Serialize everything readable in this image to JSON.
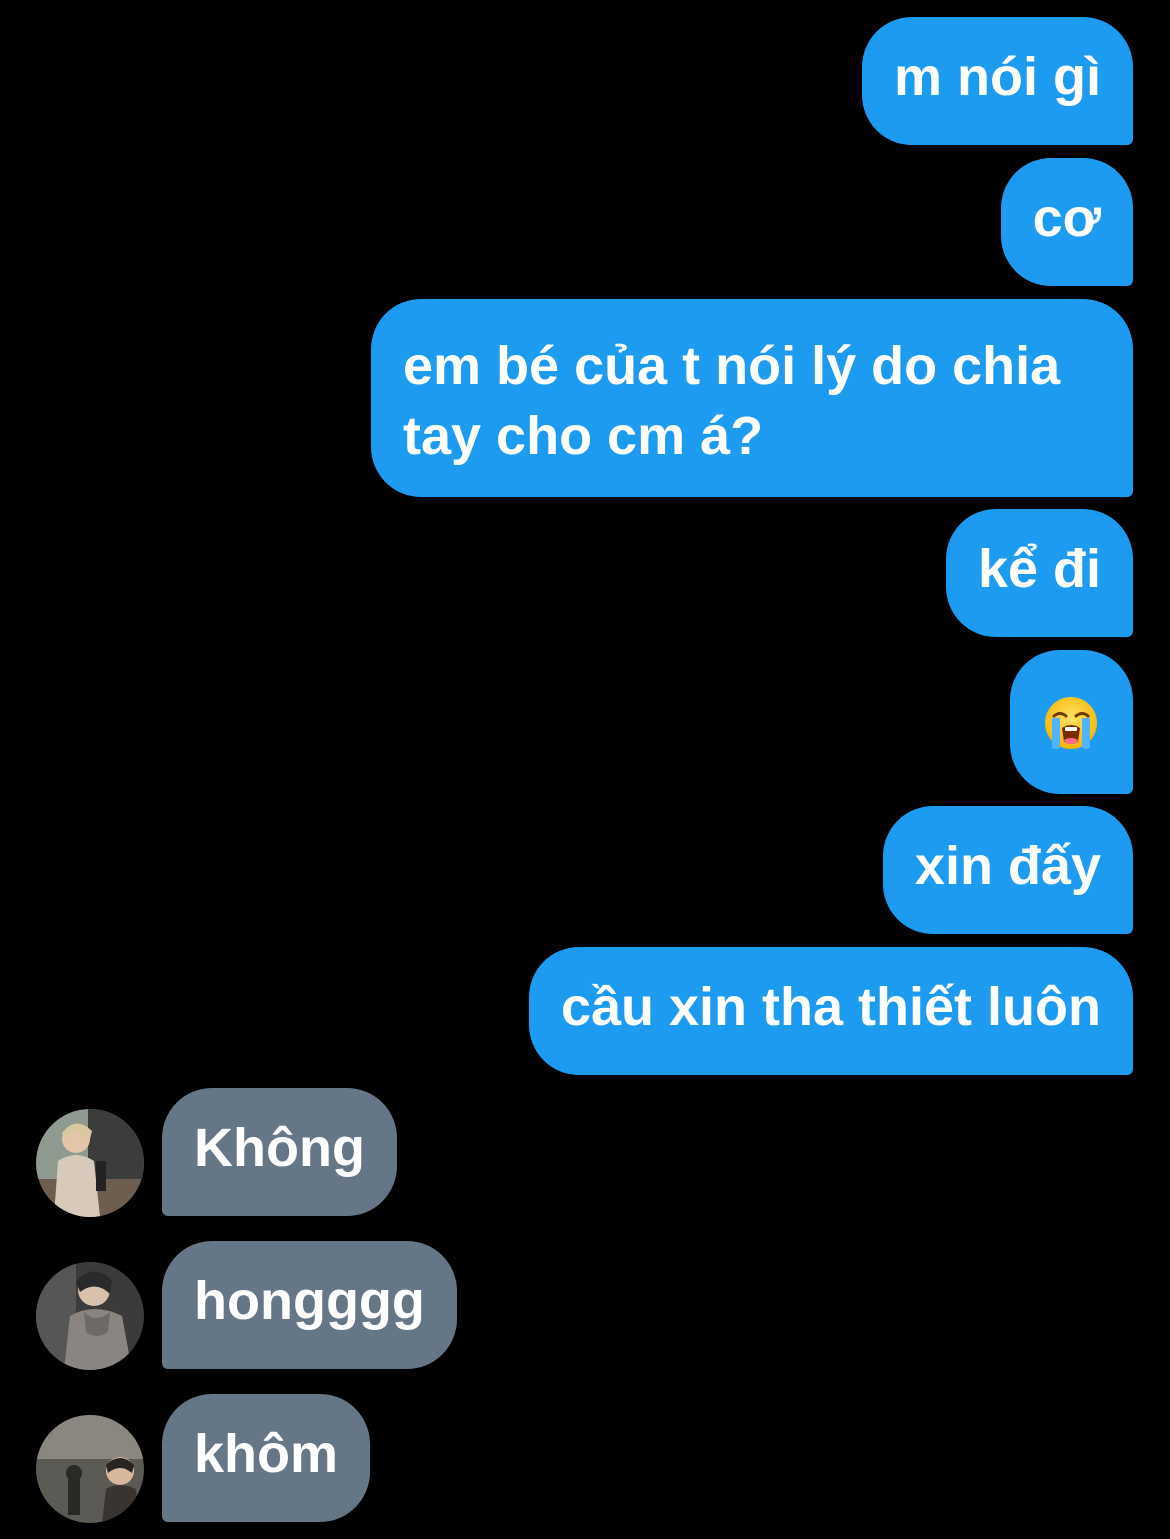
{
  "conversation": {
    "sent_messages": [
      {
        "text": "m nói gì"
      },
      {
        "text": "cơ"
      },
      {
        "text": "em bé của t nói lý do chia tay cho cm á?"
      },
      {
        "text": "kể đi"
      },
      {
        "emoji": "loudly-crying-face"
      },
      {
        "text": "xin đấy"
      },
      {
        "text": "cầu xin tha thiết luôn"
      }
    ],
    "received_messages": [
      {
        "text": "Không"
      },
      {
        "text": "hongggg"
      },
      {
        "text": "khôm"
      }
    ]
  },
  "colors": {
    "background": "#000000",
    "sent_bubble": "#1d9bf0",
    "received_bubble": "#657786",
    "text": "#ffffff"
  }
}
